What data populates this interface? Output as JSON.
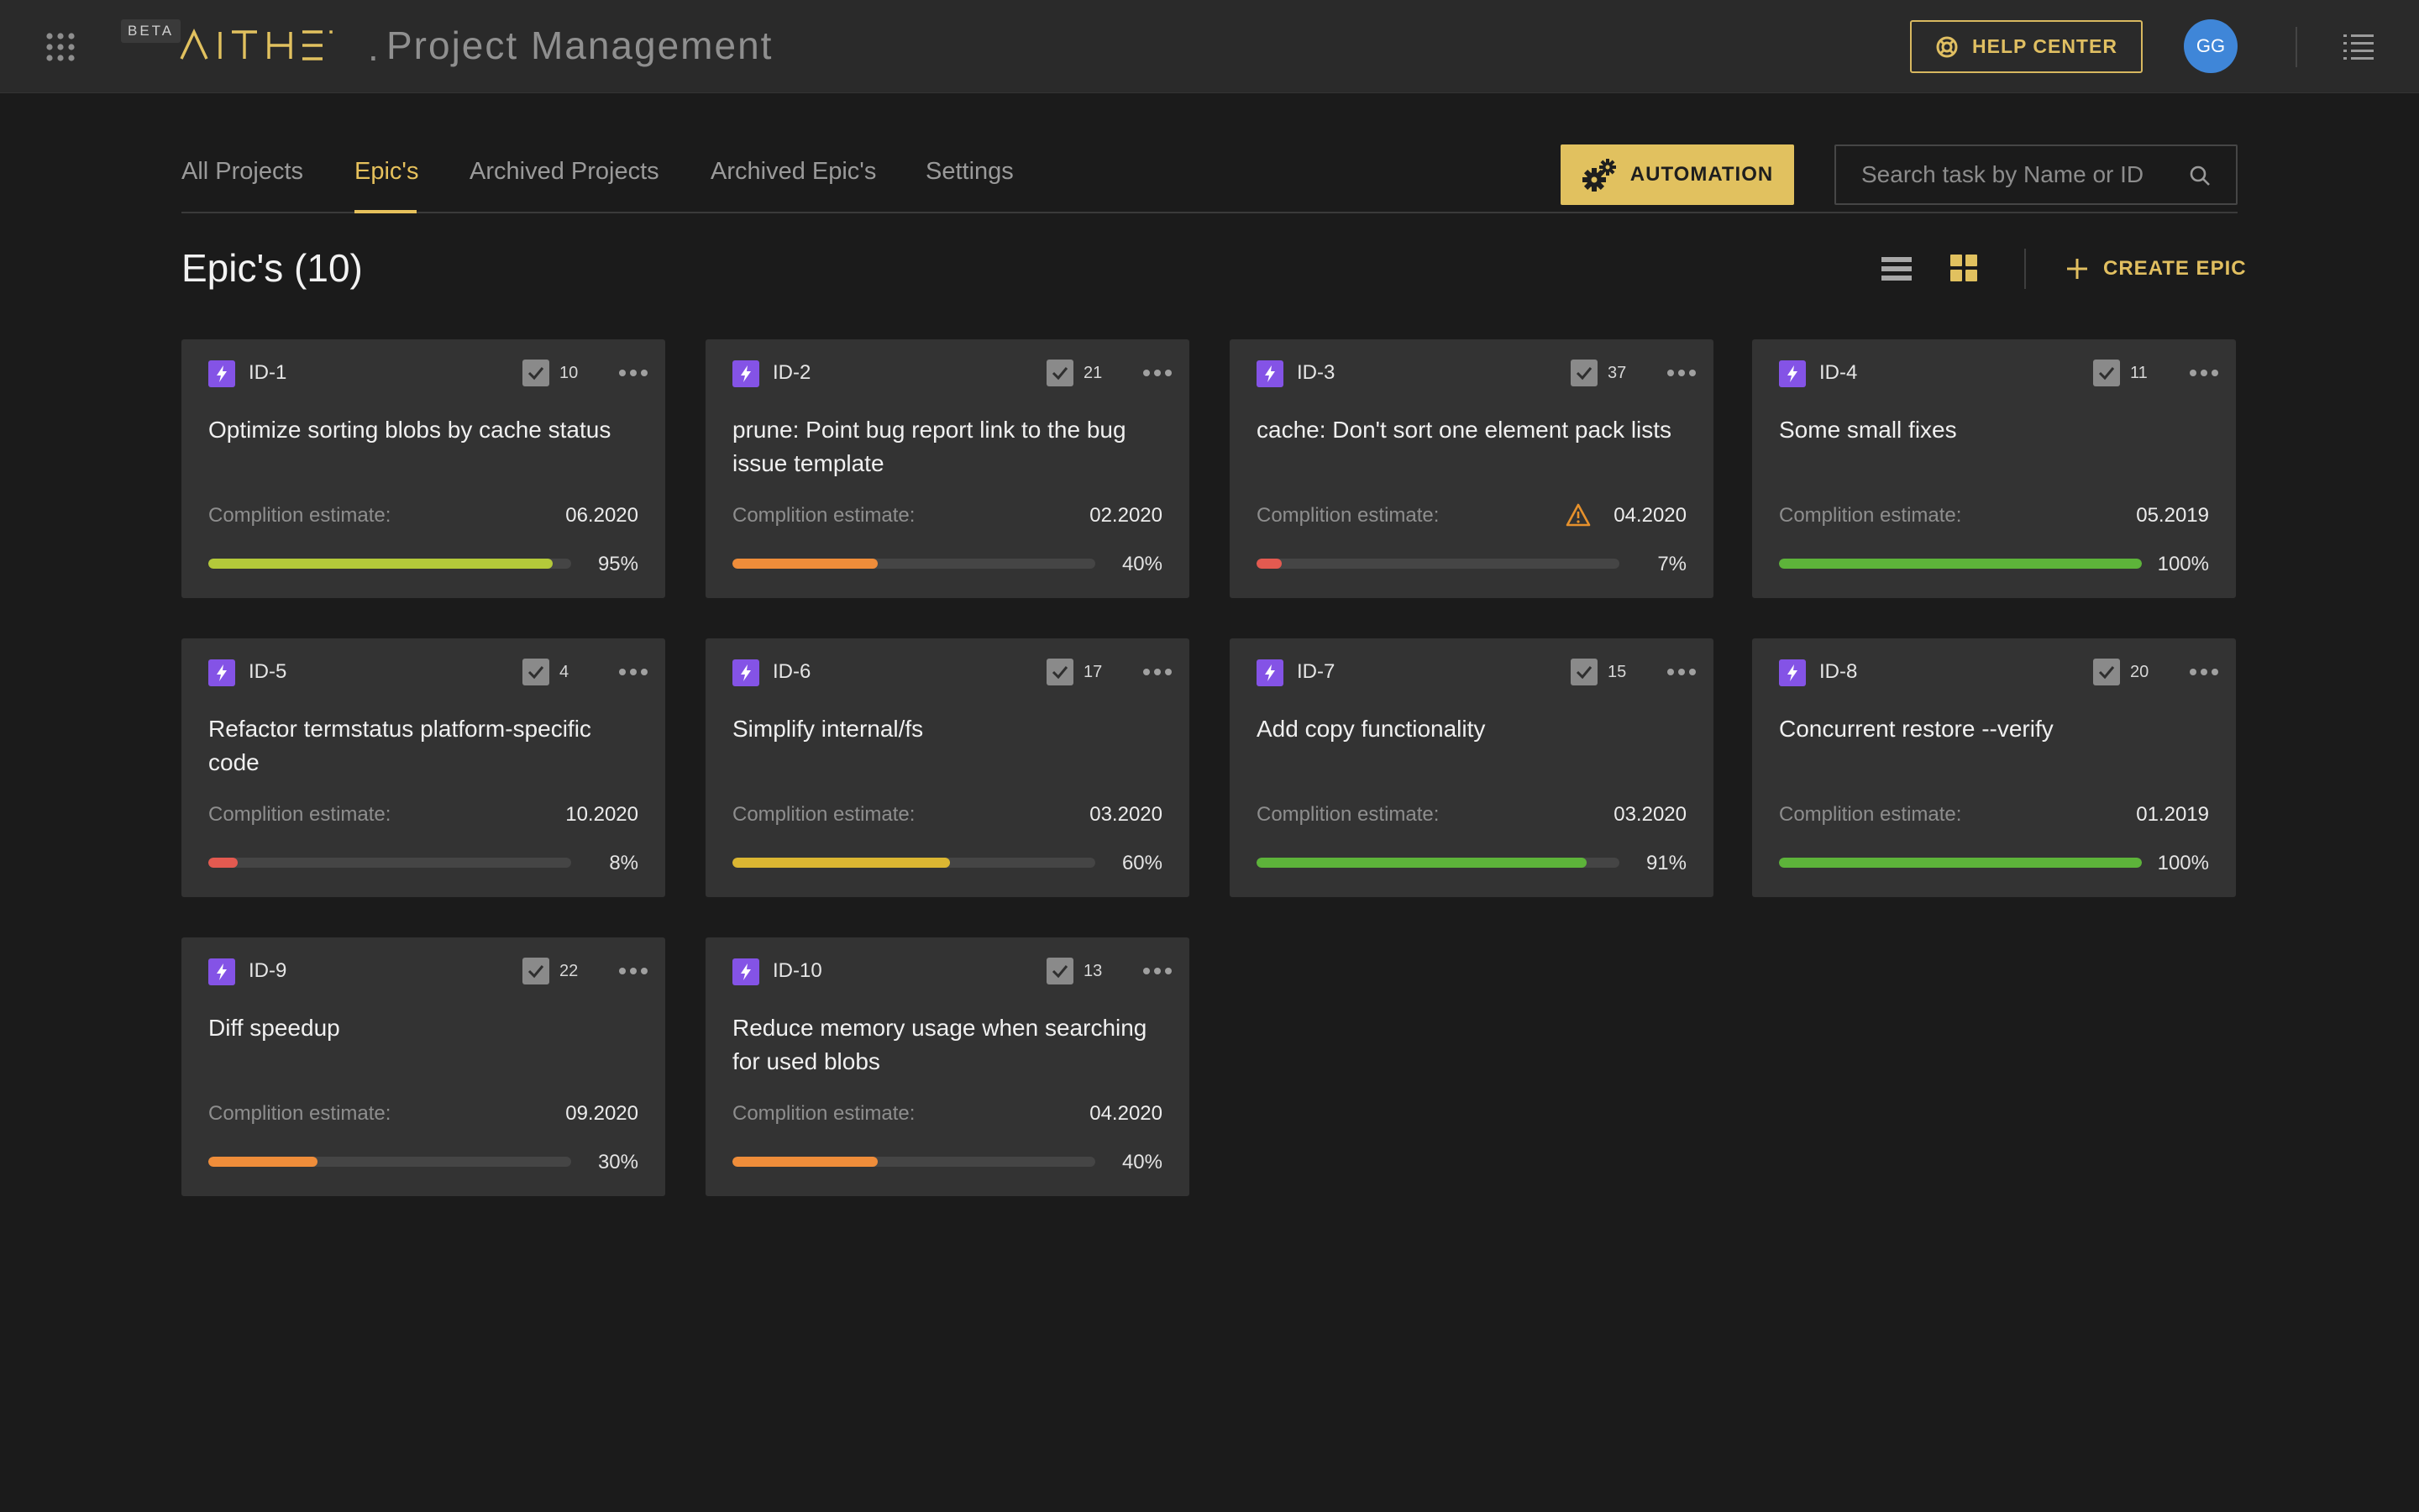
{
  "app": {
    "beta_label": "BETA",
    "brand_separator": ".",
    "title": "Project Management",
    "help_label": "HELP CENTER",
    "avatar_initials": "GG",
    "brand_color": "#e1c15f",
    "icons": [
      "apps-grid-icon",
      "aitheon-logo",
      "lifebuoy-icon",
      "hamburger-list-icon"
    ]
  },
  "tabs": [
    {
      "label": "All Projects",
      "active": false
    },
    {
      "label": "Epic's",
      "active": true
    },
    {
      "label": "Archived Projects",
      "active": false
    },
    {
      "label": "Archived Epic's",
      "active": false
    },
    {
      "label": "Settings",
      "active": false
    }
  ],
  "toolbar": {
    "automation_label": "AUTOMATION",
    "search_placeholder": "Search task by Name or ID",
    "page_title": "Epic's (10)",
    "create_label": "CREATE EPIC",
    "view_mode": "grid"
  },
  "colors": {
    "progress_high": "#b4c93a",
    "progress_orange": "#ef8d3a",
    "progress_red": "#e35a50",
    "progress_yellow": "#dbb632",
    "progress_green": "#5db33a",
    "epic_purple": "#8453e6",
    "warning": "#e6912c"
  },
  "epics": [
    {
      "id": "ID-1",
      "tasks": "10",
      "title": "Optimize sorting blobs by cache status",
      "estimate_label": "Complition estimate:",
      "estimate": "06.2020",
      "progress": 95,
      "progress_text": "95%",
      "bar_color": "#b4c93a",
      "warning": false
    },
    {
      "id": "ID-2",
      "tasks": "21",
      "title": "prune: Point bug report link to the bug issue template",
      "estimate_label": "Complition estimate:",
      "estimate": "02.2020",
      "progress": 40,
      "progress_text": "40%",
      "bar_color": "#ef8d3a",
      "warning": false
    },
    {
      "id": "ID-3",
      "tasks": "37",
      "title": "cache: Don't sort one element pack lists",
      "estimate_label": "Complition estimate:",
      "estimate": "04.2020",
      "progress": 7,
      "progress_text": "7%",
      "bar_color": "#e35a50",
      "warning": true
    },
    {
      "id": "ID-4",
      "tasks": "11",
      "title": "Some small fixes",
      "estimate_label": "Complition estimate:",
      "estimate": "05.2019",
      "progress": 100,
      "progress_text": "100%",
      "bar_color": "#5db33a",
      "warning": false
    },
    {
      "id": "ID-5",
      "tasks": "4",
      "title": "Refactor termstatus platform-specific code",
      "estimate_label": "Complition estimate:",
      "estimate": "10.2020",
      "progress": 8,
      "progress_text": "8%",
      "bar_color": "#e35a50",
      "warning": false
    },
    {
      "id": "ID-6",
      "tasks": "17",
      "title": "Simplify internal/fs",
      "estimate_label": "Complition estimate:",
      "estimate": "03.2020",
      "progress": 60,
      "progress_text": "60%",
      "bar_color": "#dbb632",
      "warning": false
    },
    {
      "id": "ID-7",
      "tasks": "15",
      "title": "Add copy functionality",
      "estimate_label": "Complition estimate:",
      "estimate": "03.2020",
      "progress": 91,
      "progress_text": "91%",
      "bar_color": "#5db33a",
      "warning": false
    },
    {
      "id": "ID-8",
      "tasks": "20",
      "title": "Concurrent restore --verify",
      "estimate_label": "Complition estimate:",
      "estimate": "01.2019",
      "progress": 100,
      "progress_text": "100%",
      "bar_color": "#5db33a",
      "warning": false
    },
    {
      "id": "ID-9",
      "tasks": "22",
      "title": "Diff speedup",
      "estimate_label": "Complition estimate:",
      "estimate": "09.2020",
      "progress": 30,
      "progress_text": "30%",
      "bar_color": "#ef8d3a",
      "warning": false
    },
    {
      "id": "ID-10",
      "tasks": "13",
      "title": "Reduce memory usage when searching for used blobs",
      "estimate_label": "Complition estimate:",
      "estimate": "04.2020",
      "progress": 40,
      "progress_text": "40%",
      "bar_color": "#ef8d3a",
      "warning": false
    }
  ]
}
